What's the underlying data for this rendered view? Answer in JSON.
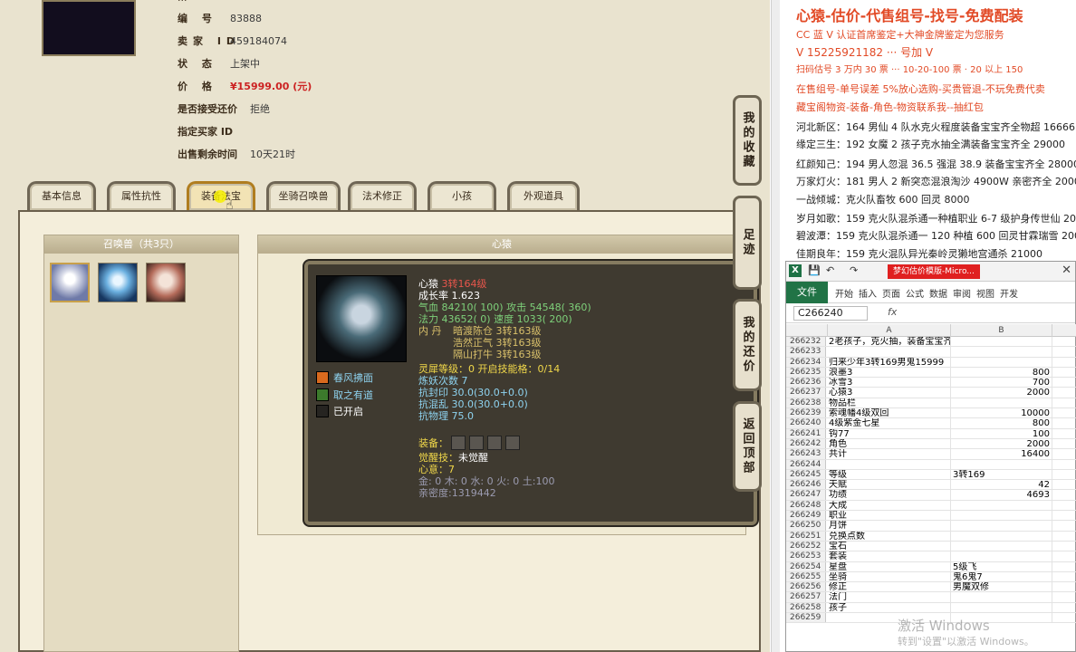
{
  "listing": {
    "top_clip": "···",
    "rows": [
      {
        "label": "编 号",
        "value": "83888"
      },
      {
        "label": "卖家 ID",
        "value": "459184074"
      },
      {
        "label": "状 态",
        "value": "上架中"
      },
      {
        "label": "价 格",
        "value": "¥15999.00 (元)"
      },
      {
        "label": "是否接受还价",
        "value": "拒绝"
      },
      {
        "label": "指定买家 ID",
        "value": ""
      },
      {
        "label": "出售剩余时间",
        "value": "10天21时"
      }
    ]
  },
  "tabs": [
    "基本信息",
    "属性抗性",
    "装备法宝",
    "坐骑召唤兽",
    "法术修正",
    "小孩",
    "外观道具"
  ],
  "summon_box": {
    "title": "召唤兽（共3只）"
  },
  "detail_box": {
    "title": "心猿"
  },
  "pet": {
    "name": "心猿",
    "level": "3转164级",
    "growth": "成长率 1.623",
    "hp_label": "气血",
    "hp": "84210( 100)",
    "atk_label": "攻击",
    "atk": "54548( 360)",
    "mp_label": "法力",
    "mp": "43652( 0)",
    "spd_label": "速度",
    "spd": "1033( 200)",
    "dan_label": "内 丹",
    "dan": [
      "暗渡陈仓 3转163级",
      "浩然正气 3转163级",
      "隔山打牛 3转163级"
    ],
    "skills": [
      "春风拂面",
      "取之有道",
      "已开启"
    ],
    "lingxi": "灵犀等级：0 开启技能格：0/14",
    "lianyao": "炼妖次数 7",
    "resist": [
      "抗封印 30.0(30.0+0.0)",
      "抗混乱 30.0(30.0+0.0)",
      "抗物理 75.0"
    ],
    "equip_label": "装备：",
    "awaken_label": "觉醒技：",
    "awaken_value": "未觉醒",
    "heart": "心意：7",
    "elements": "金: 0 木: 0 水: 0 火: 0 土:100",
    "intimacy": "亲密度:1319442"
  },
  "side_buttons": [
    "我的收藏",
    "足迹",
    "我的还价",
    "返回顶部"
  ],
  "ad": {
    "title": "心猿-估价-代售组号-找号-免费配装",
    "lines": [
      "CC 蓝 V 认证首席鉴定+大神金牌鉴定为您服务",
      "V 15225921182  ··· 号加 V",
      "扫码估号 3 万内 30 票 ··· 10-20-100 票 · 20 以上 150",
      "在售组号-单号误差 5%放心选购-买贵管退-不玩免费代卖",
      "藏宝阁物资-装备-角色-物资联系我--抽红包"
    ],
    "listings": [
      "河北新区：164 男仙 4 队水克火程度装备宝宝齐全物超 16666",
      "缘定三生：192 女魔 2 孩子克水抽全满装备宝宝齐全 29000",
      "红颜知己：194 男人忽混 36.5 强混 38.9 装备宝宝齐全 28000",
      "万家灯火：181 男人 2 新突恋混浪淘沙 4900W 亲密齐全 20000",
      "一战倾城：克火队畜牧 600 回灵 8000",
      "岁月如歌：159 克火队混杀通一种植职业 6-7 级护身传世仙 20",
      "碧波潭：159 克火队混杀通一 120 种植 600 回灵甘霖瑞雪 200",
      "佳期良年：159 克火混队异光秦岭灵獭地宫通杀 21000"
    ]
  },
  "excel": {
    "title_doc": "梦幻估价模版-Micro...",
    "quick_access": [
      "💾",
      "↶",
      "↷"
    ],
    "close": "✕",
    "file_tab": "文件",
    "ribbon_tabs": [
      "开始",
      "插入",
      "页面",
      "公式",
      "数据",
      "审阅",
      "视图",
      "开发"
    ],
    "name_box": "C266240",
    "fx": "fx",
    "col_headers": [
      "A",
      "B"
    ],
    "rows": [
      {
        "n": "266232",
        "a": "2老孩子，克火抽，装备宝宝齐全",
        "b": ""
      },
      {
        "n": "266233",
        "a": "",
        "b": ""
      },
      {
        "n": "266234",
        "a": "归来少年3转169男鬼15999",
        "b": ""
      },
      {
        "n": "266235",
        "a": "浪墨3",
        "b": "800"
      },
      {
        "n": "266236",
        "a": "冰雪3",
        "b": "700"
      },
      {
        "n": "266237",
        "a": "心猿3",
        "b": "2000"
      },
      {
        "n": "266238",
        "a": "物品栏",
        "b": ""
      },
      {
        "n": "266239",
        "a": "索魂幡4级双回",
        "b": "10000"
      },
      {
        "n": "266240",
        "a": "4级紫金七星",
        "b": "800"
      },
      {
        "n": "266241",
        "a": "钩77",
        "b": "100"
      },
      {
        "n": "266242",
        "a": "角色",
        "b": "2000"
      },
      {
        "n": "266243",
        "a": "共计",
        "b": "16400"
      },
      {
        "n": "266244",
        "a": "",
        "b": ""
      },
      {
        "n": "266245",
        "a": "等级",
        "b": "3转169"
      },
      {
        "n": "266246",
        "a": "天赋",
        "b": "42"
      },
      {
        "n": "266247",
        "a": "功绩",
        "b": "4693"
      },
      {
        "n": "266248",
        "a": "大成",
        "b": ""
      },
      {
        "n": "266249",
        "a": "职业",
        "b": ""
      },
      {
        "n": "266250",
        "a": "月饼",
        "b": ""
      },
      {
        "n": "266251",
        "a": "兑换点数",
        "b": ""
      },
      {
        "n": "266252",
        "a": "宝石",
        "b": ""
      },
      {
        "n": "266253",
        "a": "套装",
        "b": ""
      },
      {
        "n": "266254",
        "a": "星盘",
        "b": "5级飞"
      },
      {
        "n": "266255",
        "a": "坐骑",
        "b": "鬼6鬼7"
      },
      {
        "n": "266256",
        "a": "修正",
        "b": "男魔双修"
      },
      {
        "n": "266257",
        "a": "法门",
        "b": ""
      },
      {
        "n": "266258",
        "a": "孩子",
        "b": ""
      },
      {
        "n": "266259",
        "a": "",
        "b": ""
      }
    ]
  },
  "watermark": {
    "line1": "激活 Windows",
    "line2": "转到\"设置\"以激活 Windows。"
  },
  "colors": {
    "price": "#cc2222",
    "ad_text": "#e24a26",
    "excel_green": "#217346",
    "tab_active": "#b07d1f"
  }
}
